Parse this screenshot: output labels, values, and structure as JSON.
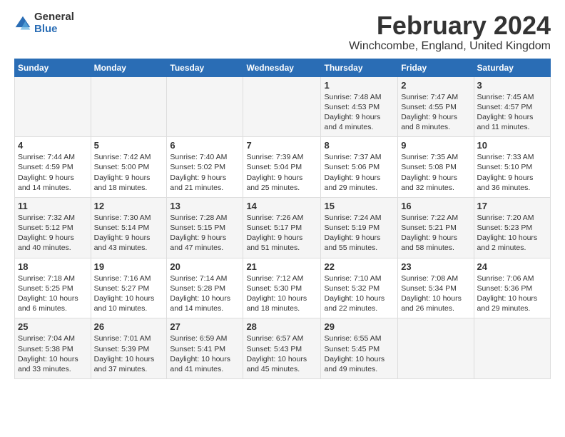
{
  "logo": {
    "general": "General",
    "blue": "Blue"
  },
  "title": "February 2024",
  "subtitle": "Winchcombe, England, United Kingdom",
  "weekdays": [
    "Sunday",
    "Monday",
    "Tuesday",
    "Wednesday",
    "Thursday",
    "Friday",
    "Saturday"
  ],
  "weeks": [
    [
      {
        "day": "",
        "info": ""
      },
      {
        "day": "",
        "info": ""
      },
      {
        "day": "",
        "info": ""
      },
      {
        "day": "",
        "info": ""
      },
      {
        "day": "1",
        "info": "Sunrise: 7:48 AM\nSunset: 4:53 PM\nDaylight: 9 hours\nand 4 minutes."
      },
      {
        "day": "2",
        "info": "Sunrise: 7:47 AM\nSunset: 4:55 PM\nDaylight: 9 hours\nand 8 minutes."
      },
      {
        "day": "3",
        "info": "Sunrise: 7:45 AM\nSunset: 4:57 PM\nDaylight: 9 hours\nand 11 minutes."
      }
    ],
    [
      {
        "day": "4",
        "info": "Sunrise: 7:44 AM\nSunset: 4:59 PM\nDaylight: 9 hours\nand 14 minutes."
      },
      {
        "day": "5",
        "info": "Sunrise: 7:42 AM\nSunset: 5:00 PM\nDaylight: 9 hours\nand 18 minutes."
      },
      {
        "day": "6",
        "info": "Sunrise: 7:40 AM\nSunset: 5:02 PM\nDaylight: 9 hours\nand 21 minutes."
      },
      {
        "day": "7",
        "info": "Sunrise: 7:39 AM\nSunset: 5:04 PM\nDaylight: 9 hours\nand 25 minutes."
      },
      {
        "day": "8",
        "info": "Sunrise: 7:37 AM\nSunset: 5:06 PM\nDaylight: 9 hours\nand 29 minutes."
      },
      {
        "day": "9",
        "info": "Sunrise: 7:35 AM\nSunset: 5:08 PM\nDaylight: 9 hours\nand 32 minutes."
      },
      {
        "day": "10",
        "info": "Sunrise: 7:33 AM\nSunset: 5:10 PM\nDaylight: 9 hours\nand 36 minutes."
      }
    ],
    [
      {
        "day": "11",
        "info": "Sunrise: 7:32 AM\nSunset: 5:12 PM\nDaylight: 9 hours\nand 40 minutes."
      },
      {
        "day": "12",
        "info": "Sunrise: 7:30 AM\nSunset: 5:14 PM\nDaylight: 9 hours\nand 43 minutes."
      },
      {
        "day": "13",
        "info": "Sunrise: 7:28 AM\nSunset: 5:15 PM\nDaylight: 9 hours\nand 47 minutes."
      },
      {
        "day": "14",
        "info": "Sunrise: 7:26 AM\nSunset: 5:17 PM\nDaylight: 9 hours\nand 51 minutes."
      },
      {
        "day": "15",
        "info": "Sunrise: 7:24 AM\nSunset: 5:19 PM\nDaylight: 9 hours\nand 55 minutes."
      },
      {
        "day": "16",
        "info": "Sunrise: 7:22 AM\nSunset: 5:21 PM\nDaylight: 9 hours\nand 58 minutes."
      },
      {
        "day": "17",
        "info": "Sunrise: 7:20 AM\nSunset: 5:23 PM\nDaylight: 10 hours\nand 2 minutes."
      }
    ],
    [
      {
        "day": "18",
        "info": "Sunrise: 7:18 AM\nSunset: 5:25 PM\nDaylight: 10 hours\nand 6 minutes."
      },
      {
        "day": "19",
        "info": "Sunrise: 7:16 AM\nSunset: 5:27 PM\nDaylight: 10 hours\nand 10 minutes."
      },
      {
        "day": "20",
        "info": "Sunrise: 7:14 AM\nSunset: 5:28 PM\nDaylight: 10 hours\nand 14 minutes."
      },
      {
        "day": "21",
        "info": "Sunrise: 7:12 AM\nSunset: 5:30 PM\nDaylight: 10 hours\nand 18 minutes."
      },
      {
        "day": "22",
        "info": "Sunrise: 7:10 AM\nSunset: 5:32 PM\nDaylight: 10 hours\nand 22 minutes."
      },
      {
        "day": "23",
        "info": "Sunrise: 7:08 AM\nSunset: 5:34 PM\nDaylight: 10 hours\nand 26 minutes."
      },
      {
        "day": "24",
        "info": "Sunrise: 7:06 AM\nSunset: 5:36 PM\nDaylight: 10 hours\nand 29 minutes."
      }
    ],
    [
      {
        "day": "25",
        "info": "Sunrise: 7:04 AM\nSunset: 5:38 PM\nDaylight: 10 hours\nand 33 minutes."
      },
      {
        "day": "26",
        "info": "Sunrise: 7:01 AM\nSunset: 5:39 PM\nDaylight: 10 hours\nand 37 minutes."
      },
      {
        "day": "27",
        "info": "Sunrise: 6:59 AM\nSunset: 5:41 PM\nDaylight: 10 hours\nand 41 minutes."
      },
      {
        "day": "28",
        "info": "Sunrise: 6:57 AM\nSunset: 5:43 PM\nDaylight: 10 hours\nand 45 minutes."
      },
      {
        "day": "29",
        "info": "Sunrise: 6:55 AM\nSunset: 5:45 PM\nDaylight: 10 hours\nand 49 minutes."
      },
      {
        "day": "",
        "info": ""
      },
      {
        "day": "",
        "info": ""
      }
    ]
  ]
}
